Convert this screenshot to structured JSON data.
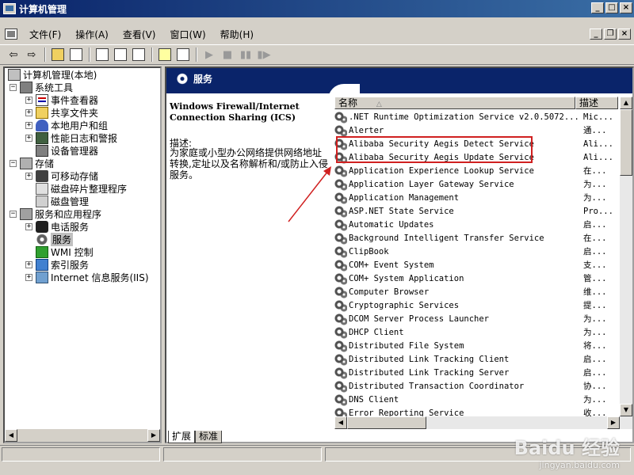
{
  "window": {
    "title": "计算机管理",
    "min": "_",
    "max": "□",
    "close": "×"
  },
  "menu": {
    "items": [
      "文件(F)",
      "操作(A)",
      "查看(V)",
      "窗口(W)",
      "帮助(H)"
    ],
    "doc_min": "_",
    "doc_restore": "❐",
    "doc_close": "×"
  },
  "toolbar": {
    "back": "⇦",
    "forward": "⇨",
    "play": "▶",
    "stop": "■",
    "pause": "▮▮",
    "restart": "▮▶"
  },
  "tree": {
    "root": "计算机管理(本地)",
    "system_tools": "系统工具",
    "event_viewer": "事件查看器",
    "shared_folders": "共享文件夹",
    "local_users": "本地用户和组",
    "perf_logs": "性能日志和警报",
    "device_manager": "设备管理器",
    "storage": "存储",
    "removable_storage": "可移动存储",
    "defrag": "磁盘碎片整理程序",
    "disk_management": "磁盘管理",
    "services_apps": "服务和应用程序",
    "telephony": "电话服务",
    "services": "服务",
    "wmi": "WMI 控制",
    "indexing": "索引服务",
    "iis": "Internet 信息服务(IIS)"
  },
  "panel": {
    "header": "服务"
  },
  "detail": {
    "service_title": "Windows Firewall/Internet Connection Sharing (ICS)",
    "desc_label": "描述:",
    "desc_text": "为家庭或小型办公网络提供网络地址转换,定址以及名称解析和/或防止入侵服务。"
  },
  "list": {
    "col_name": "名称",
    "sort_indicator": "△",
    "col_desc": "描述",
    "rows": [
      {
        "name": ".NET Runtime Optimization Service v2.0.5072...",
        "desc": "Mic..."
      },
      {
        "name": "Alerter",
        "desc": "通..."
      },
      {
        "name": "Alibaba Security Aegis Detect Service",
        "desc": "Ali..."
      },
      {
        "name": "Alibaba Security Aegis Update Service",
        "desc": "Ali..."
      },
      {
        "name": "Application Experience Lookup Service",
        "desc": "在..."
      },
      {
        "name": "Application Layer Gateway Service",
        "desc": "为..."
      },
      {
        "name": "Application Management",
        "desc": "为..."
      },
      {
        "name": "ASP.NET State Service",
        "desc": "Pro..."
      },
      {
        "name": "Automatic Updates",
        "desc": "启..."
      },
      {
        "name": "Background Intelligent Transfer Service",
        "desc": "在..."
      },
      {
        "name": "ClipBook",
        "desc": "启..."
      },
      {
        "name": "COM+ Event System",
        "desc": "支..."
      },
      {
        "name": "COM+ System Application",
        "desc": "管..."
      },
      {
        "name": "Computer Browser",
        "desc": "维..."
      },
      {
        "name": "Cryptographic Services",
        "desc": "提..."
      },
      {
        "name": "DCOM Server Process Launcher",
        "desc": "为..."
      },
      {
        "name": "DHCP Client",
        "desc": "为..."
      },
      {
        "name": "Distributed File System",
        "desc": "将..."
      },
      {
        "name": "Distributed Link Tracking Client",
        "desc": "启..."
      },
      {
        "name": "Distributed Link Tracking Server",
        "desc": "启..."
      },
      {
        "name": "Distributed Transaction Coordinator",
        "desc": "协..."
      },
      {
        "name": "DNS Client",
        "desc": "为..."
      },
      {
        "name": "Error Reporting Service",
        "desc": "收..."
      }
    ]
  },
  "tabs": {
    "extended": "扩展",
    "standard": "标准"
  },
  "watermark": {
    "main": "Baidu 经验",
    "sub": "jingyan.baidu.com"
  }
}
